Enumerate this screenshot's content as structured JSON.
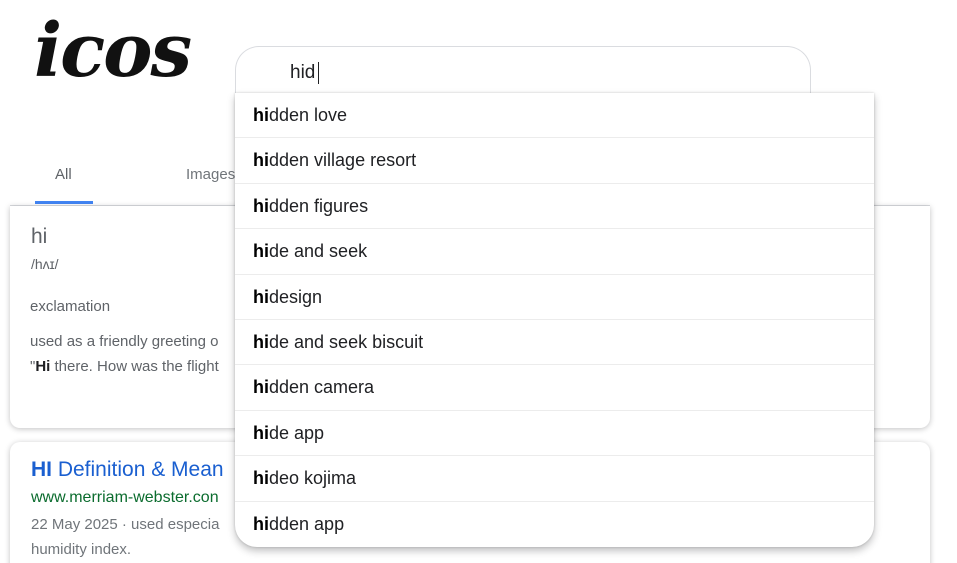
{
  "logo": {
    "text": "icos"
  },
  "search": {
    "value": "hid"
  },
  "tabs": [
    {
      "label": "All"
    },
    {
      "label": "Images"
    }
  ],
  "dictionary": {
    "word": "hi",
    "phonetic": "/hʌɪ/",
    "part_of_speech": "exclamation",
    "definition": "used as a friendly greeting o",
    "example_open_quote": "\"",
    "example_bold": "Hi",
    "example_rest": " there. How was the flight"
  },
  "result": {
    "title_bold": "HI",
    "title_rest": " Definition & Mean",
    "url": "www.merriam-webster.con",
    "snippet_line1": "22 May 2025 · used especia",
    "snippet_line2": "humidity index."
  },
  "suggestions": [
    {
      "match": "hi",
      "rest": "dden love"
    },
    {
      "match": "hi",
      "rest": "dden village resort"
    },
    {
      "match": "hi",
      "rest": "dden figures"
    },
    {
      "match": "hi",
      "rest": "de and seek"
    },
    {
      "match": "hi",
      "rest": "design"
    },
    {
      "match": "hi",
      "rest": "de and seek biscuit"
    },
    {
      "match": "hi",
      "rest": "dden camera"
    },
    {
      "match": "hi",
      "rest": "de app"
    },
    {
      "match": "hi",
      "rest": "deo kojima"
    },
    {
      "match": "hi",
      "rest": "dden app"
    }
  ]
}
